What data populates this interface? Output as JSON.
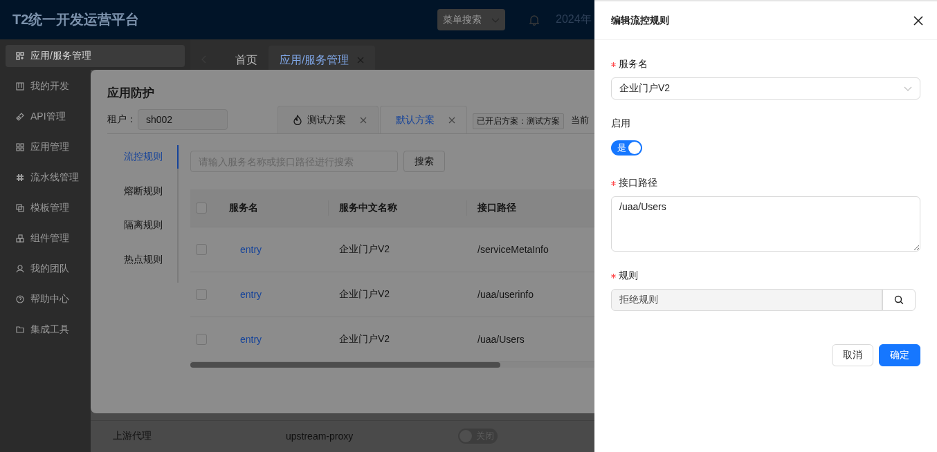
{
  "header": {
    "title": "T2统一开发运营平台",
    "menu_search": {
      "placeholder": "菜单搜索"
    },
    "date": "2024年"
  },
  "sidebar": {
    "items": [
      {
        "label": "应用/服务管理",
        "selected": true
      },
      {
        "label": "我的开发",
        "selected": false
      },
      {
        "label": "API管理",
        "selected": false
      },
      {
        "label": "应用管理",
        "selected": false
      },
      {
        "label": "流水线管理",
        "selected": false
      },
      {
        "label": "模板管理",
        "selected": false
      },
      {
        "label": "组件管理",
        "selected": false
      },
      {
        "label": "我的团队",
        "selected": false
      },
      {
        "label": "帮助中心",
        "selected": false
      },
      {
        "label": "集成工具",
        "selected": false
      }
    ]
  },
  "page_tabs": [
    {
      "label": "首页",
      "selected": false,
      "closable": false
    },
    {
      "label": "应用/服务管理",
      "selected": true,
      "closable": true
    }
  ],
  "background_row": {
    "name": "上游代理",
    "code": "upstream-proxy",
    "switch": {
      "on": false,
      "label": "关闭"
    }
  },
  "modal": {
    "title": "应用防护",
    "tenant": {
      "label": "租户：",
      "value": "sh002"
    },
    "scheme_tabs": [
      {
        "label": "测试方案",
        "selected": false,
        "has_icon": true
      },
      {
        "label": "默认方案",
        "selected": true,
        "has_icon": false
      }
    ],
    "active_scheme_tag": "已开启方案：测试方案",
    "current_label": "当前",
    "side_tabs": [
      {
        "label": "流控规则",
        "selected": true
      },
      {
        "label": "熔断规则",
        "selected": false
      },
      {
        "label": "隔离规则",
        "selected": false
      },
      {
        "label": "热点规则",
        "selected": false
      }
    ],
    "search": {
      "placeholder": "请输入服务名称或接口路径进行搜索",
      "button": "搜索"
    },
    "table": {
      "header_checked": false,
      "columns": [
        "服务名",
        "服务中文名称",
        "接口路径"
      ],
      "rows": [
        {
          "checked": false,
          "cells": [
            "entry",
            "企业门户V2",
            "/serviceMetaInfo"
          ]
        },
        {
          "checked": false,
          "cells": [
            "entry",
            "企业门户V2",
            "/uaa/userinfo"
          ]
        },
        {
          "checked": false,
          "cells": [
            "entry",
            "企业门户V2",
            "/uaa/Users"
          ]
        }
      ]
    }
  },
  "drawer": {
    "title": "编辑流控规则",
    "fields": [
      {
        "kind": "select",
        "label": "服务名",
        "required": true,
        "value": "企业门户V2"
      },
      {
        "kind": "switch",
        "label": "启用",
        "required": false,
        "on": true,
        "text": "是"
      },
      {
        "kind": "textarea",
        "label": "接口路径",
        "required": true,
        "value": "/uaa/Users"
      },
      {
        "kind": "lookup",
        "label": "规则",
        "required": true,
        "value": "拒绝规则"
      }
    ],
    "buttons": [
      {
        "label": "取消",
        "primary": false
      },
      {
        "label": "确定",
        "primary": true
      }
    ]
  }
}
